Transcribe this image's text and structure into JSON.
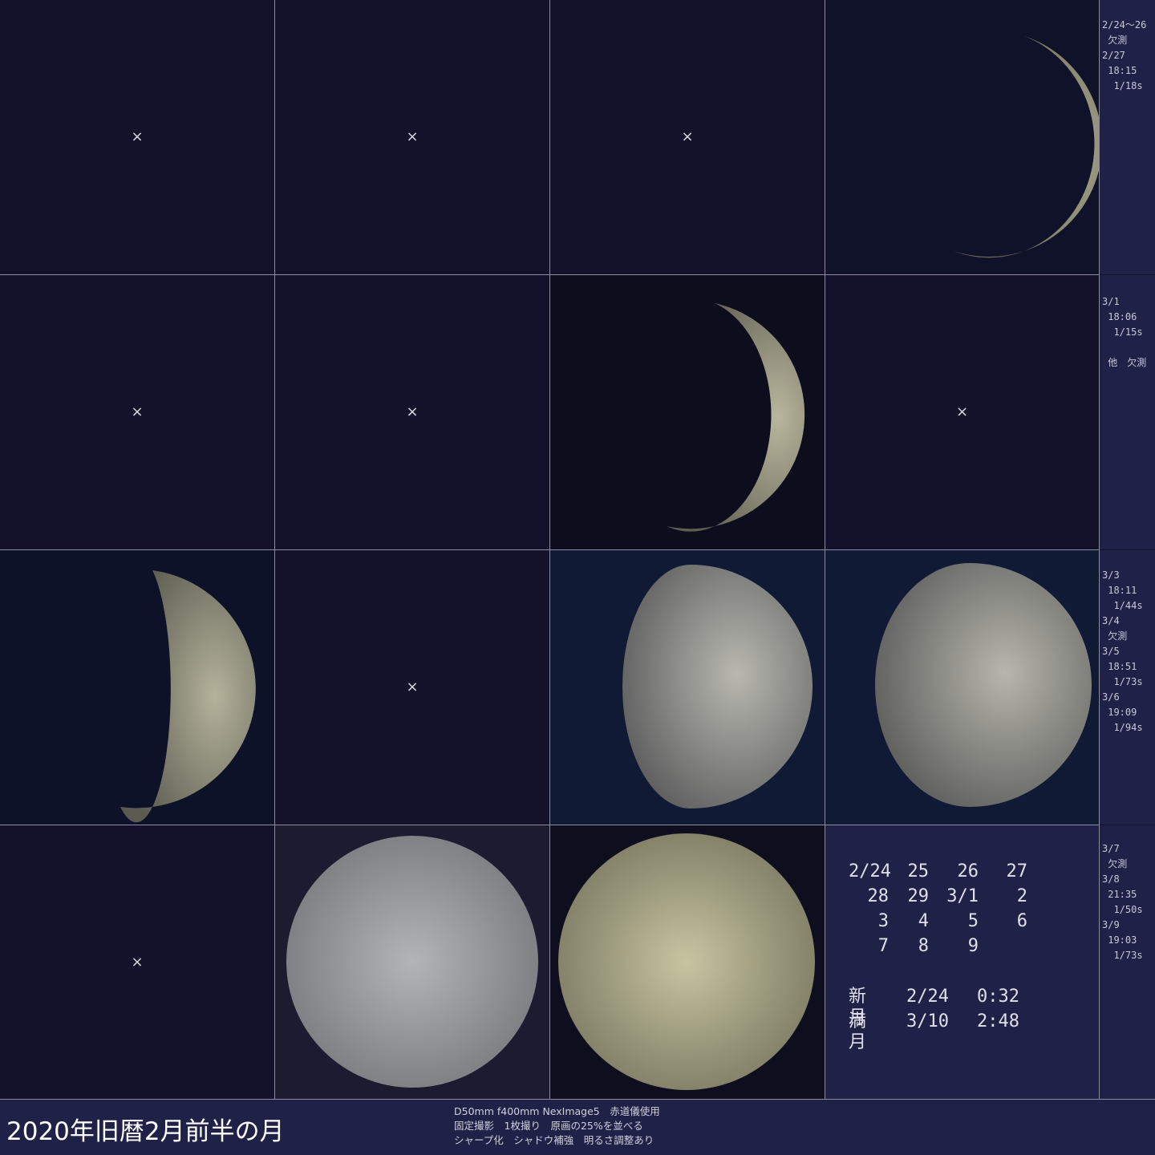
{
  "title": "2020年旧暦2月前半の月",
  "notes": [
    "D50mm f400mm NexImage5　赤道儀使用",
    "固定撮影　1枚撮り　原画の25%を並べる",
    "シャープ化　シャドウ補強　明るさ調整あり"
  ],
  "missing_mark": "×",
  "side_notes": [
    "2/24〜26\n 欠測\n2/27\n 18:15\n  1/18s",
    "3/1\n 18:06\n  1/15s\n\n 他　欠測",
    "3/3\n 18:11\n  1/44s\n3/4\n 欠測\n3/5\n 18:51\n  1/73s\n3/6\n 19:09\n  1/94s",
    "3/7\n 欠測\n3/8\n 21:35\n  1/50s\n3/9\n 19:03\n  1/73s"
  ],
  "calendar": {
    "rows": [
      [
        "2/24",
        "25",
        "26",
        "27"
      ],
      [
        "28",
        "29",
        "3/1",
        "2"
      ],
      [
        "3",
        "4",
        "5",
        "6"
      ],
      [
        "7",
        "8",
        "9",
        ""
      ]
    ],
    "new_moon": {
      "label": "新月",
      "date": "2/24",
      "time": "0:32"
    },
    "full_moon": {
      "label": "満月",
      "date": "3/10",
      "time": "2:48"
    }
  },
  "colors": {
    "background": "#13122a",
    "panel": "#1f2147",
    "grid": "#8a8aa0",
    "moon_light": "#c8c6a8",
    "moon_dark": "#5e5d52"
  }
}
